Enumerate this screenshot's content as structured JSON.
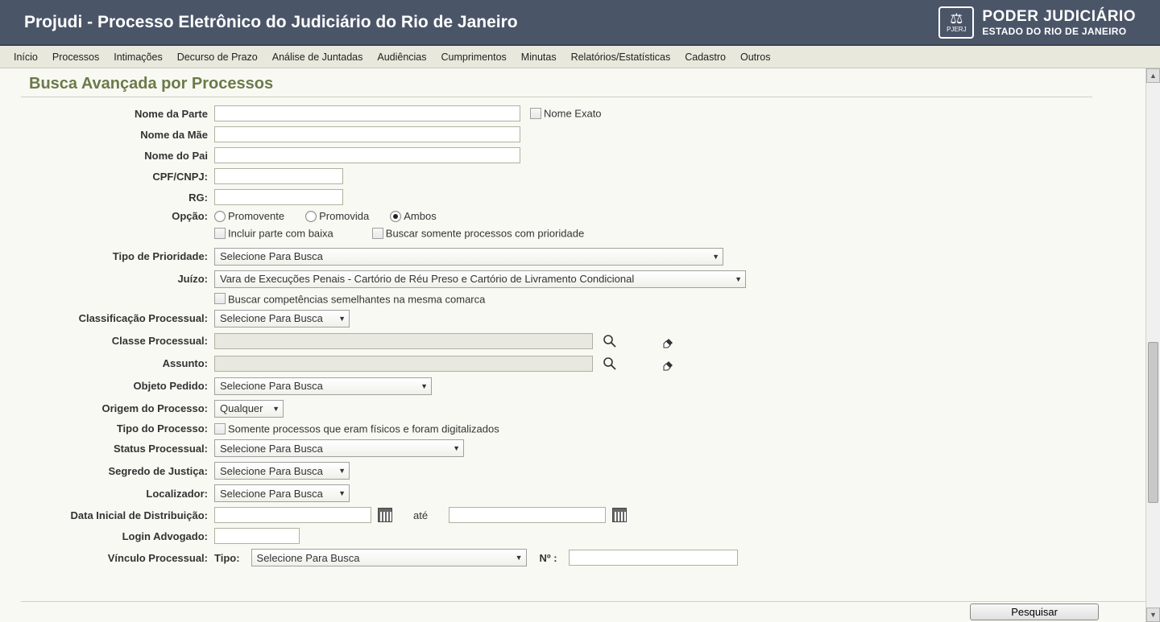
{
  "header": {
    "title": "Projudi - Processo Eletrônico do Judiciário do Rio de Janeiro",
    "right_line1": "PODER JUDICIÁRIO",
    "right_line2": "ESTADO DO RIO DE JANEIRO",
    "logo_small": "PJERJ"
  },
  "menu": [
    "Início",
    "Processos",
    "Intimações",
    "Decurso de Prazo",
    "Análise de Juntadas",
    "Audiências",
    "Cumprimentos",
    "Minutas",
    "Relatórios/Estatísticas",
    "Cadastro",
    "Outros"
  ],
  "page_title": "Busca Avançada por Processos",
  "labels": {
    "nome_parte": "Nome da Parte",
    "nome_exato": "Nome Exato",
    "nome_mae": "Nome da Mãe",
    "nome_pai": "Nome do Pai",
    "cpf_cnpj": "CPF/CNPJ:",
    "rg": "RG:",
    "opcao": "Opção:",
    "promovente": "Promovente",
    "promovida": "Promovida",
    "ambos": "Ambos",
    "incluir_baixa": "Incluir parte com baixa",
    "buscar_prioridade": "Buscar somente processos com prioridade",
    "tipo_prioridade": "Tipo de Prioridade:",
    "juizo": "Juízo:",
    "buscar_competencias": "Buscar competências semelhantes na mesma comarca",
    "class_processual": "Classificação Processual:",
    "classe_processual": "Classe Processual:",
    "assunto": "Assunto:",
    "objeto_pedido": "Objeto Pedido:",
    "origem_processo": "Origem do Processo:",
    "tipo_processo": "Tipo do Processo:",
    "somente_fisicos": "Somente processos que eram físicos e foram digitalizados",
    "status_processual": "Status Processual:",
    "segredo_justica": "Segredo de Justiça:",
    "localizador": "Localizador:",
    "data_inicial": "Data Inicial de Distribuição:",
    "ate": "até",
    "login_advogado": "Login Advogado:",
    "vinculo_processual": "Vínculo Processual:",
    "tipo_sub": "Tipo:",
    "no_sub": "Nº :"
  },
  "selects": {
    "placeholder_busca": "Selecione Para Busca",
    "juizo_value": "Vara de Execuções Penais - Cartório de Réu Preso e Cartório de Livramento Condicional",
    "origem_value": "Qualquer"
  },
  "buttons": {
    "pesquisar": "Pesquisar"
  }
}
